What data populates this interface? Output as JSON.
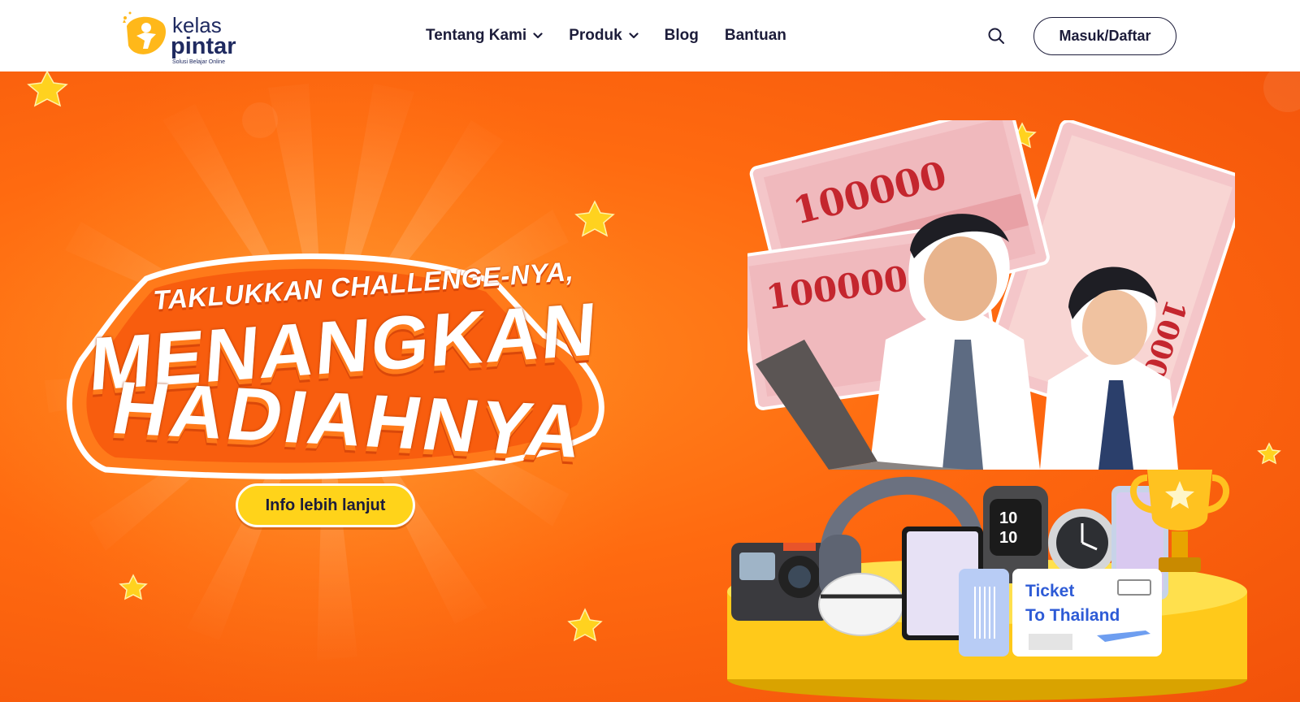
{
  "brand": {
    "logo_line1": "kelas",
    "logo_line2": "pintar",
    "tagline": "Solusi Belajar Online",
    "colors": {
      "navy": "#1f2a60",
      "orange": "#ff6a10",
      "yellow": "#ffd31a",
      "ticket_blue": "#2e5bd6"
    }
  },
  "nav": {
    "items": [
      {
        "label": "Tentang Kami",
        "has_dropdown": true,
        "icon": "chevron-down-icon"
      },
      {
        "label": "Produk",
        "has_dropdown": true,
        "icon": "chevron-down-icon"
      },
      {
        "label": "Blog",
        "has_dropdown": false
      },
      {
        "label": "Bantuan",
        "has_dropdown": false
      }
    ],
    "search_icon": "search-icon",
    "login_label": "Masuk/Daftar"
  },
  "hero": {
    "headline_small": "TAKLUKKAN CHALLENGE-NYA,",
    "headline_big1": "MENANGKAN",
    "headline_big2": "HADIAHNYA",
    "cta_label": "Info lebih lanjut",
    "banknote_value": "100000",
    "ticket_line1": "Ticket",
    "ticket_line2": "To Thailand"
  }
}
